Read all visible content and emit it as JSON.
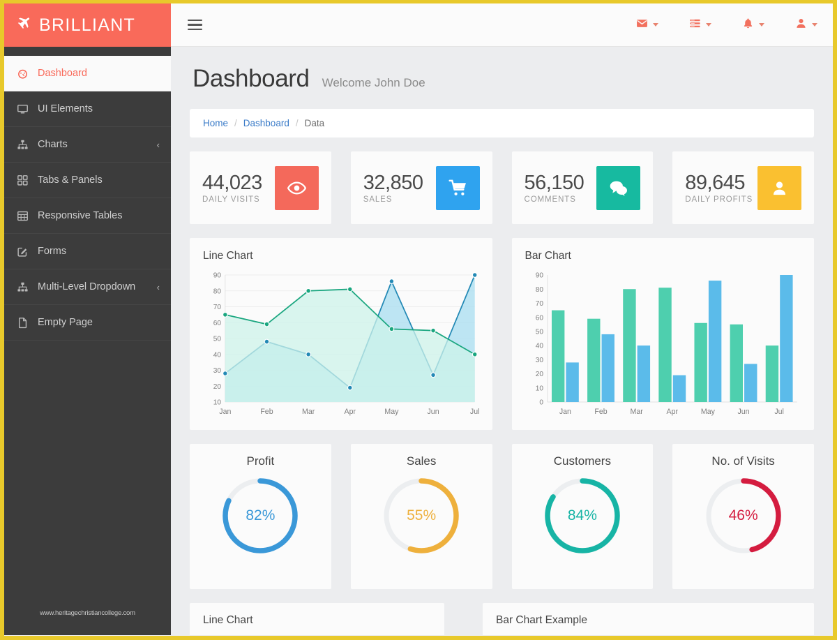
{
  "brand": {
    "icon": "plane-icon",
    "name": "BRILLIANT"
  },
  "sidebar": {
    "items": [
      {
        "label": "Dashboard",
        "icon": "tachometer-icon",
        "active": true,
        "chevron": ""
      },
      {
        "label": "UI Elements",
        "icon": "desktop-icon",
        "active": false,
        "chevron": ""
      },
      {
        "label": "Charts",
        "icon": "sitemap-icon",
        "active": false,
        "chevron": "‹"
      },
      {
        "label": "Tabs & Panels",
        "icon": "grid-icon",
        "active": false,
        "chevron": ""
      },
      {
        "label": "Responsive Tables",
        "icon": "table-icon",
        "active": false,
        "chevron": ""
      },
      {
        "label": "Forms",
        "icon": "edit-icon",
        "active": false,
        "chevron": ""
      },
      {
        "label": "Multi-Level Dropdown",
        "icon": "sitemap-icon",
        "active": false,
        "chevron": "‹"
      },
      {
        "label": "Empty Page",
        "icon": "file-icon",
        "active": false,
        "chevron": ""
      }
    ],
    "watermark": "www.heritagechristiancollege.com"
  },
  "topbar": {
    "menu_toggle": "hamburger-icon",
    "icons": [
      {
        "name": "envelope-icon",
        "glyph": "✉"
      },
      {
        "name": "tasks-icon",
        "glyph": "☰"
      },
      {
        "name": "bell-icon",
        "glyph": "🔔"
      },
      {
        "name": "user-icon",
        "glyph": "👤"
      }
    ]
  },
  "page": {
    "title": "Dashboard",
    "subtitle": "Welcome John Doe"
  },
  "breadcrumb": {
    "home": "Home",
    "dashboard": "Dashboard",
    "current": "Data",
    "separator": "/"
  },
  "stats": [
    {
      "value": "44,023",
      "label": "DAILY VISITS",
      "icon": "eye-icon",
      "glyph": "👁",
      "color": "#f4695b"
    },
    {
      "value": "32,850",
      "label": "SALES",
      "icon": "cart-icon",
      "glyph": "🛒",
      "color": "#2fa3ef"
    },
    {
      "value": "56,150",
      "label": "COMMENTS",
      "icon": "comments-icon",
      "glyph": "💬",
      "color": "#17baa0"
    },
    {
      "value": "89,645",
      "label": "DAILY PROFITS",
      "icon": "user-icon",
      "glyph": "👤",
      "color": "#fac030"
    }
  ],
  "chart_data": [
    {
      "type": "line",
      "title": "Line Chart",
      "categories": [
        "Jan",
        "Feb",
        "Mar",
        "Apr",
        "May",
        "Jun",
        "Jul"
      ],
      "series": [
        {
          "name": "green",
          "color": "#1aa67f",
          "fill": "#cdf3ea",
          "values": [
            65,
            59,
            80,
            81,
            56,
            55,
            40
          ]
        },
        {
          "name": "blue",
          "color": "#2389b5",
          "fill": "#a8def0",
          "values": [
            28,
            48,
            40,
            19,
            86,
            27,
            90
          ]
        }
      ],
      "ylim": [
        10,
        90
      ],
      "yticks": [
        10,
        20,
        30,
        40,
        50,
        60,
        70,
        80,
        90
      ],
      "xlabel": "",
      "ylabel": "",
      "grid": true,
      "legend": false
    },
    {
      "type": "bar",
      "title": "Bar Chart",
      "categories": [
        "Jan",
        "Feb",
        "Mar",
        "Apr",
        "May",
        "Jun",
        "Jul"
      ],
      "series": [
        {
          "name": "green",
          "color": "#4ecfae",
          "values": [
            65,
            59,
            80,
            81,
            56,
            55,
            40
          ]
        },
        {
          "name": "blue",
          "color": "#5bbbea",
          "values": [
            28,
            48,
            40,
            19,
            86,
            27,
            90
          ]
        }
      ],
      "ylim": [
        0,
        90
      ],
      "yticks": [
        0,
        10,
        20,
        30,
        40,
        50,
        60,
        70,
        80,
        90
      ],
      "xlabel": "",
      "ylabel": "",
      "grid": false,
      "legend": false
    },
    {
      "type": "pie",
      "title": "Profit",
      "value": 82,
      "display": "82%",
      "color": "#3a98d8",
      "track": "#eceef0"
    },
    {
      "type": "pie",
      "title": "Sales",
      "value": 55,
      "display": "55%",
      "color": "#eeb03c",
      "track": "#eceef0"
    },
    {
      "type": "pie",
      "title": "Customers",
      "value": 84,
      "display": "84%",
      "color": "#17b4a5",
      "track": "#eceef0"
    },
    {
      "type": "pie",
      "title": "No. of Visits",
      "value": 46,
      "display": "46%",
      "color": "#d41c3f",
      "track": "#eceef0"
    }
  ],
  "bottom_panels": [
    {
      "title": "Line Chart"
    },
    {
      "title": "Bar Chart Example"
    }
  ]
}
